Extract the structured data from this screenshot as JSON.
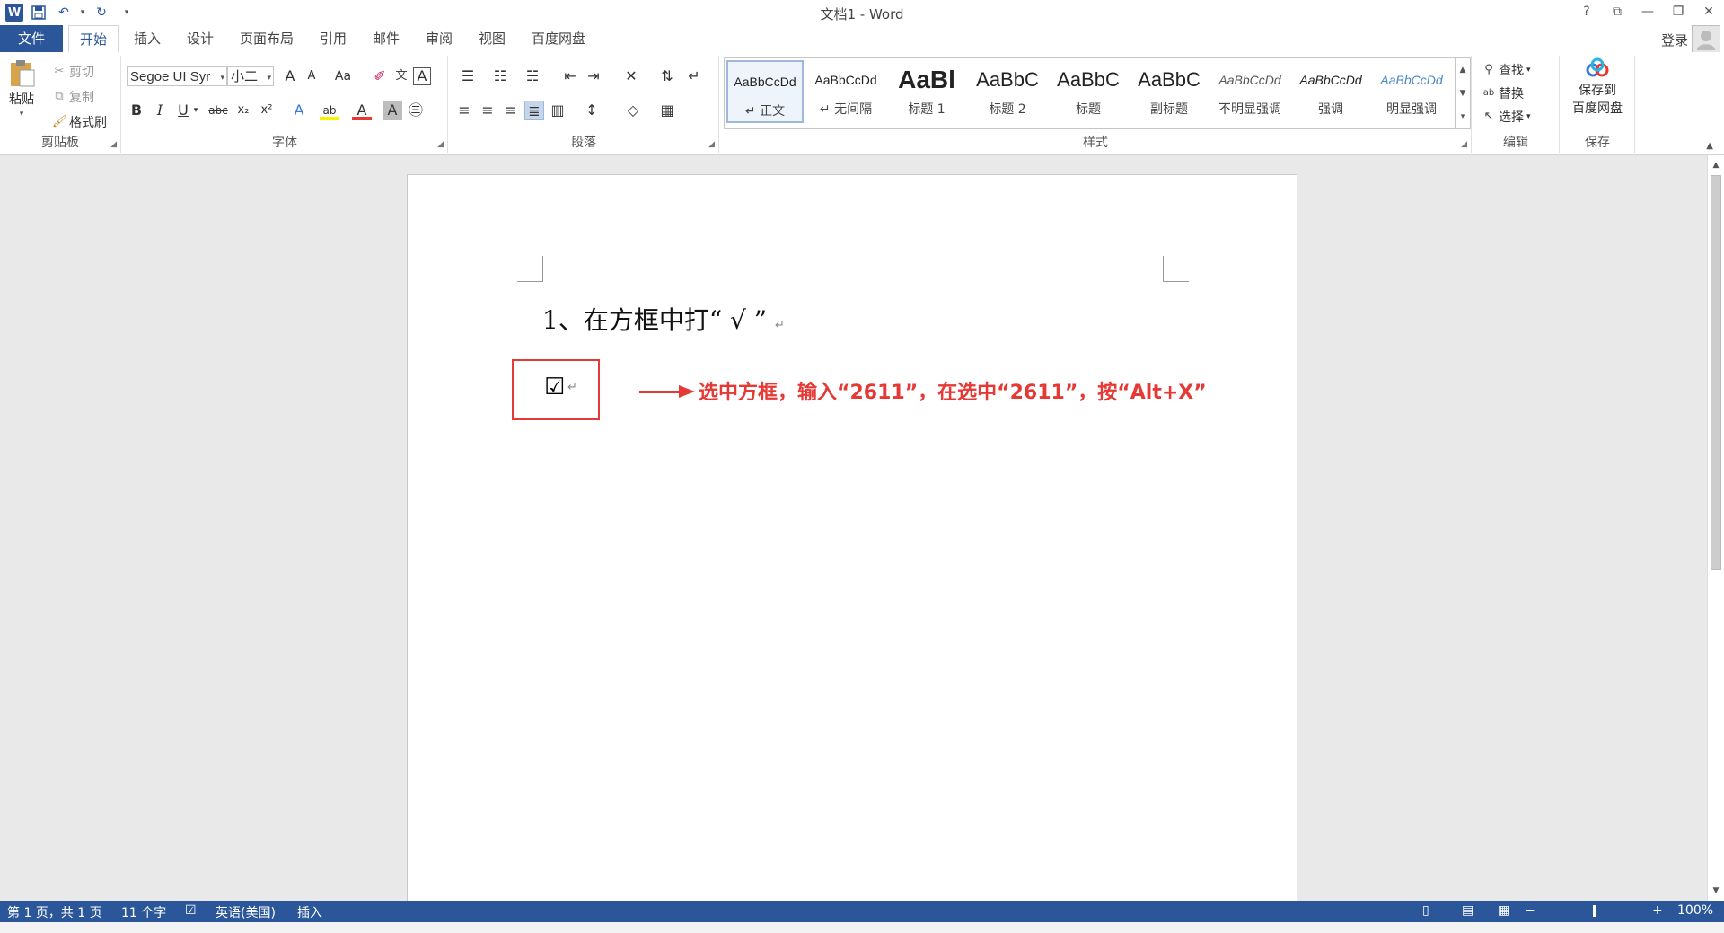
{
  "window": {
    "title": "文档1 - Word",
    "help": "?",
    "ribbon_display": "⧉",
    "minimize": "—",
    "restore": "❐",
    "close": "✕"
  },
  "qat": {
    "app": "W",
    "save": "💾",
    "undo": "↶",
    "undo_arrow": "▾",
    "redo": "↻",
    "customize": "▾"
  },
  "tabs": [
    {
      "label": "文件"
    },
    {
      "label": "开始"
    },
    {
      "label": "插入"
    },
    {
      "label": "设计"
    },
    {
      "label": "页面布局"
    },
    {
      "label": "引用"
    },
    {
      "label": "邮件"
    },
    {
      "label": "审阅"
    },
    {
      "label": "视图"
    },
    {
      "label": "百度网盘"
    }
  ],
  "account": {
    "login": "登录"
  },
  "clipboard": {
    "label": "剪贴板",
    "paste": "粘贴",
    "cut": "剪切",
    "copy": "复制",
    "format_painter": "格式刷"
  },
  "font": {
    "label": "字体",
    "font_name": "Segoe UI Syr",
    "font_size": "小二",
    "bold": "B",
    "italic": "I",
    "underline": "U",
    "strike": "abc",
    "subscript": "x₂",
    "superscript": "x²",
    "grow": "A",
    "shrink": "A",
    "case": "Aa",
    "clear": "✐",
    "phonetic": "文",
    "border": "A",
    "text_effect": "A",
    "highlight": "ab",
    "font_color": "A",
    "shade": "A",
    "enclose": "㊂"
  },
  "paragraph": {
    "label": "段落"
  },
  "styles": {
    "label": "样式",
    "items": [
      {
        "sample": "AaBbCcDd",
        "name": "↵ 正文"
      },
      {
        "sample": "AaBbCcDd",
        "name": "↵ 无间隔"
      },
      {
        "sample": "AaBl",
        "name": "标题 1"
      },
      {
        "sample": "AaBbC",
        "name": "标题 2"
      },
      {
        "sample": "AaBbC",
        "name": "标题"
      },
      {
        "sample": "AaBbC",
        "name": "副标题"
      },
      {
        "sample": "AaBbCcDd",
        "name": "不明显强调"
      },
      {
        "sample": "AaBbCcDd",
        "name": "强调"
      },
      {
        "sample": "AaBbCcDd",
        "name": "明显强调"
      }
    ]
  },
  "editing": {
    "label": "编辑",
    "find": "查找",
    "replace": "替换",
    "select": "选择"
  },
  "save_group": {
    "label": "保存",
    "save_line1": "保存到",
    "save_line2": "百度网盘"
  },
  "document": {
    "line1": "1、在方框中打“ √ ”",
    "checkbox": "☑",
    "paragraph_mark": "↵",
    "annotation": "选中方框，输入“2611”，在选中“2611”，按“Alt+X”"
  },
  "status": {
    "page": "第 1 页，共 1 页",
    "words": "11 个字",
    "language": "英语(美国)",
    "mode": "插入",
    "zoom_out": "−",
    "zoom_in": "+",
    "zoom": "100%"
  },
  "colors": {
    "brand": "#2b579a",
    "annotation_red": "#e53935"
  }
}
